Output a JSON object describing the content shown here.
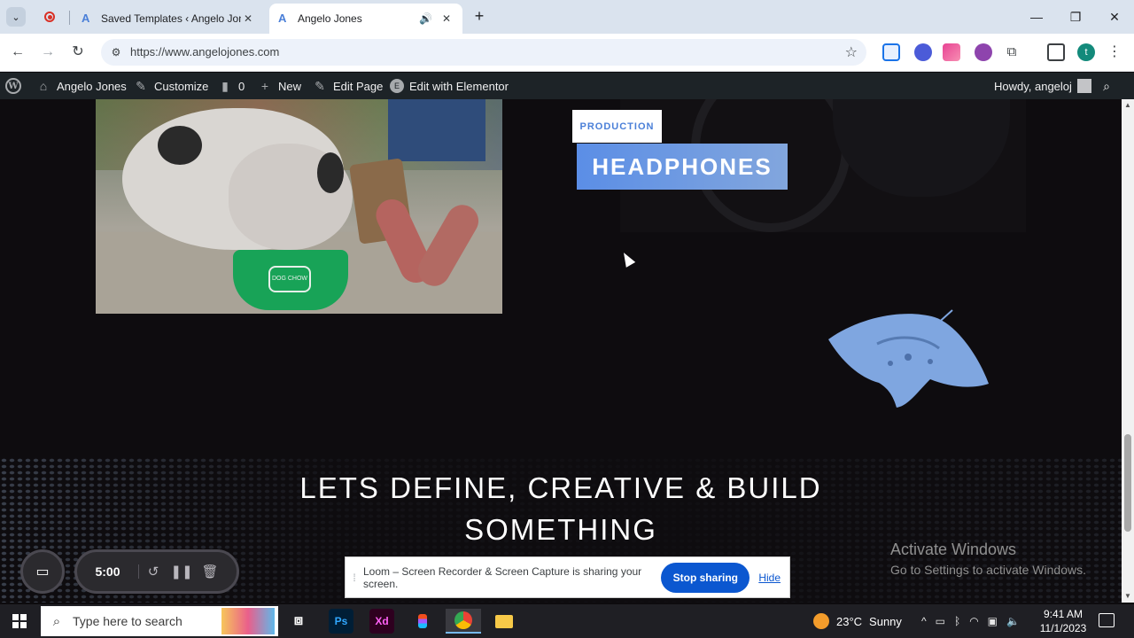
{
  "browser": {
    "tabs": [
      {
        "title": "Saved Templates ‹ Angelo Jone",
        "active": false
      },
      {
        "title": "Angelo Jones",
        "active": true
      }
    ],
    "url": "https://www.angelojones.com",
    "profile_initial": "t",
    "new_tab_symbol": "+",
    "window_controls": [
      "—",
      "❐",
      "✕"
    ]
  },
  "admin_bar": {
    "site_name": "Angelo Jones",
    "customize": "Customize",
    "comments_count": "0",
    "new": "New",
    "edit_page": "Edit Page",
    "edit_with_elementor": "Edit with Elementor",
    "greeting": "Howdy, angeloj"
  },
  "page": {
    "badge": "PRODUCTION",
    "title": "HEADPHONES",
    "cta_line1": "LETS DEFINE, CREATIVE & BUILD",
    "cta_line2": "SOMETHING",
    "bowl_label": "DOG CHOW"
  },
  "watermark": {
    "line1": "Activate Windows",
    "line2": "Go to Settings to activate Windows."
  },
  "loom": {
    "timer": "5:00",
    "share_message": "Loom – Screen Recorder & Screen Capture is sharing your screen.",
    "stop_label": "Stop sharing",
    "hide_label": "Hide"
  },
  "taskbar": {
    "search_placeholder": "Type here to search",
    "apps": [
      "Ps",
      "Xd"
    ],
    "weather_temp": "23°C",
    "weather_desc": "Sunny",
    "time": "9:41 AM",
    "date": "11/1/2023"
  },
  "colors": {
    "accent_blue": "#5b8ee6",
    "admin_bar": "#1d2327",
    "stop_button": "#0b57d0"
  }
}
